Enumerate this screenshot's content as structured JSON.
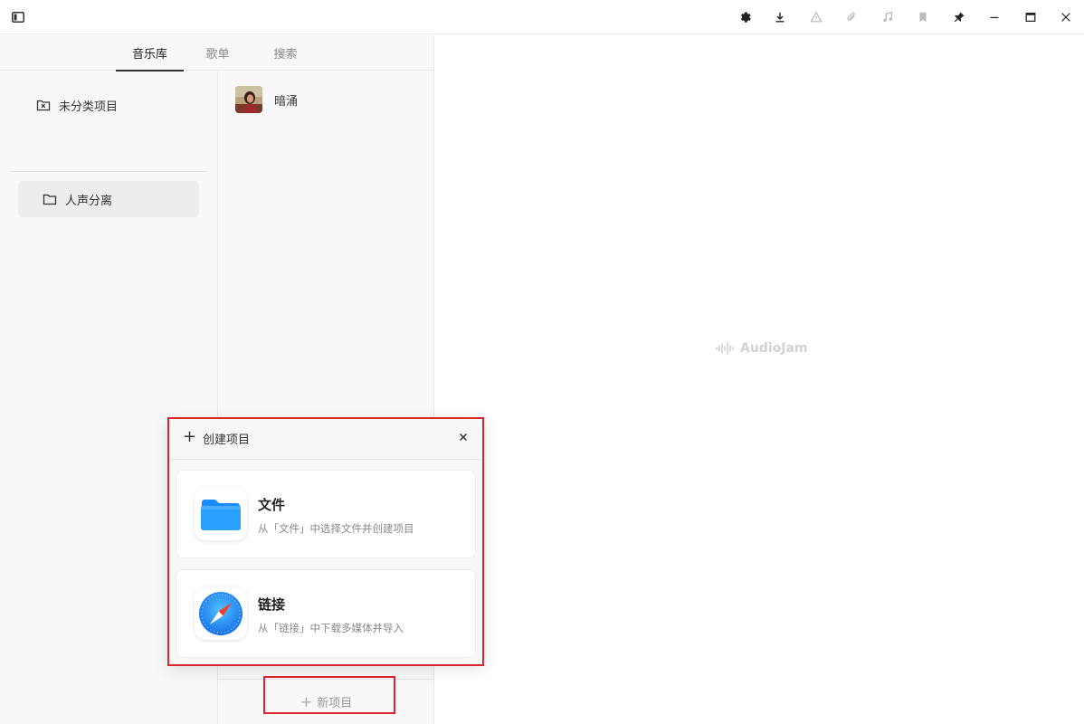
{
  "tabs": [
    {
      "label": "音乐库",
      "active": true
    },
    {
      "label": "歌单",
      "active": false
    },
    {
      "label": "搜索",
      "active": false
    }
  ],
  "folders": [
    {
      "label": "未分类项目",
      "icon": "folder-x-icon",
      "selected": false
    },
    {
      "label": "人声分离",
      "icon": "folder-icon",
      "selected": true
    }
  ],
  "songs": [
    {
      "title": "暗涌",
      "icon": "album-cover"
    }
  ],
  "new_project": {
    "label": "新项目"
  },
  "brand": {
    "name": "AudioJam"
  },
  "popup": {
    "title": "创建项目",
    "options": [
      {
        "title": "文件",
        "desc": "从「文件」中选择文件并创建项目",
        "icon": "files-app-icon"
      },
      {
        "title": "链接",
        "desc": "从「链接」中下载多媒体并导入",
        "icon": "safari-compass-icon"
      }
    ]
  },
  "toolbar_icons": [
    "settings-icon",
    "download-icon",
    "alert-icon",
    "attachment-icon",
    "music-note-icon",
    "bookmark-icon",
    "pin-icon",
    "minimize-icon",
    "maximize-icon",
    "close-icon"
  ],
  "colors": {
    "highlight": "#d9252f",
    "files_blue": "#1a8cff",
    "safari_blue": "#1e90ff"
  }
}
